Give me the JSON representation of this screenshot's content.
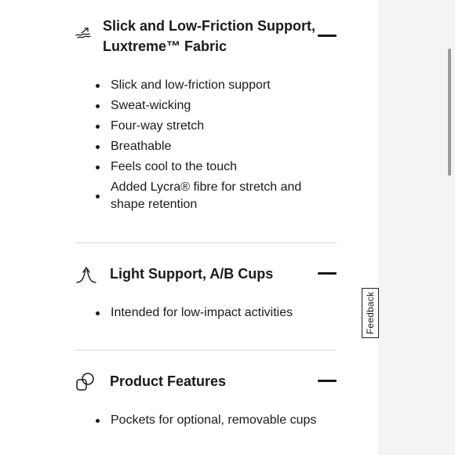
{
  "sections": [
    {
      "title_line1": "Slick and Low-Friction Support,",
      "title_line2": "Luxtreme™ Fabric",
      "icon": "fabric-wave-icon",
      "items": [
        "Slick and low-friction support",
        "Sweat-wicking",
        "Four-way stretch",
        "Breathable",
        "Feels cool to the touch",
        "Added Lycra® fibre for stretch and shape retention"
      ]
    },
    {
      "title": "Light Support, A/B Cups",
      "icon": "light-support-icon",
      "items": [
        "Intended for low-impact activities"
      ]
    },
    {
      "title": "Product Features",
      "icon": "product-features-icon",
      "items": [
        "Pockets for optional, removable cups"
      ]
    }
  ],
  "feedback": {
    "label": "Feedback"
  }
}
